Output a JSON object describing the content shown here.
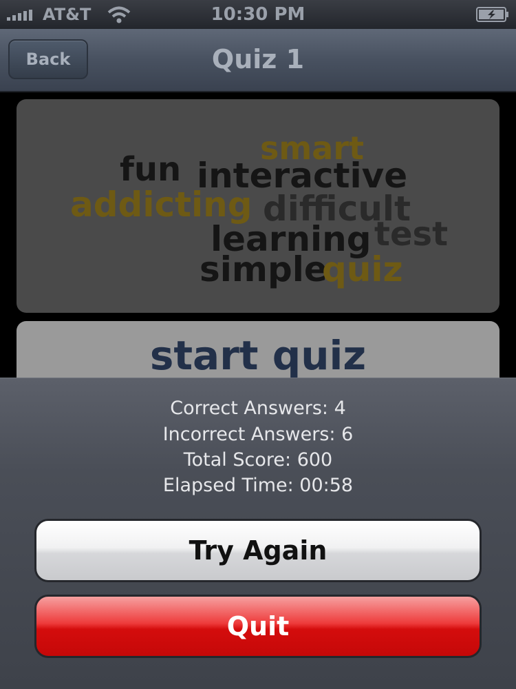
{
  "status_bar": {
    "carrier": "AT&T",
    "time": "10:30 PM",
    "signal_icon": "signal-bars-icon",
    "wifi_icon": "wifi-icon",
    "battery_icon": "battery-charging-icon"
  },
  "nav": {
    "back_label": "Back",
    "title": "Quiz 1"
  },
  "word_cloud": {
    "words": [
      {
        "text": "smart",
        "color": "#6e5a14"
      },
      {
        "text": "fun",
        "color": "#151515"
      },
      {
        "text": "interactive",
        "color": "#151515"
      },
      {
        "text": "addicting",
        "color": "#6e5a14"
      },
      {
        "text": "difficult",
        "color": "#2a2a2a"
      },
      {
        "text": "learning",
        "color": "#151515"
      },
      {
        "text": "test",
        "color": "#2a2a2a"
      },
      {
        "text": "simple",
        "color": "#151515"
      },
      {
        "text": "quiz",
        "color": "#6e5a14"
      }
    ]
  },
  "start_quiz_label": "start quiz",
  "results": {
    "correct": "Correct Answers: 4",
    "incorrect": "Incorrect Answers: 6",
    "score": "Total Score: 600",
    "elapsed": "Elapsed Time: 00:58"
  },
  "actions": {
    "try_again_label": "Try Again",
    "quit_label": "Quit"
  },
  "colors": {
    "quit_red": "#d40d0d",
    "nav_blue_gray": "#485160",
    "start_quiz_text": "#223049"
  }
}
